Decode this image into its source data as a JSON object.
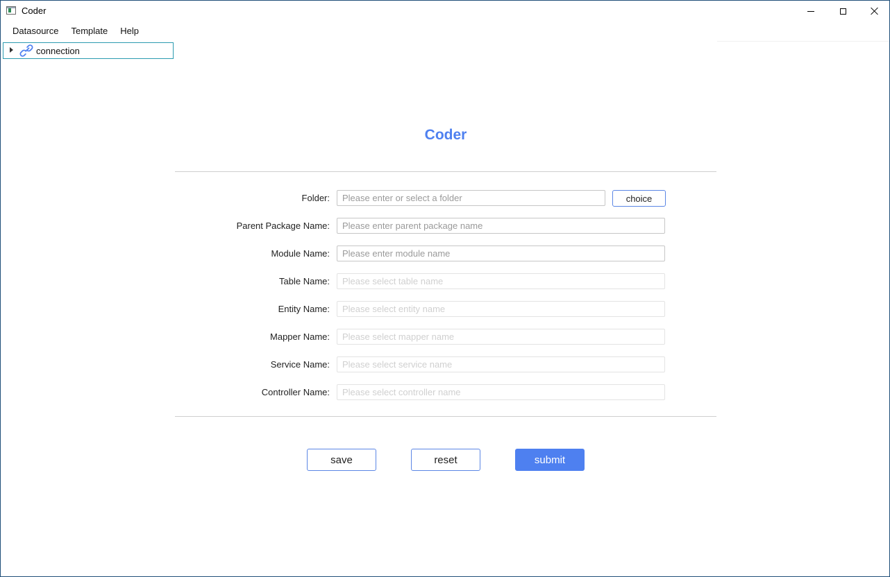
{
  "window": {
    "title": "Coder"
  },
  "menu": {
    "items": [
      "Datasource",
      "Template",
      "Help"
    ]
  },
  "tree": {
    "root_label": "connection"
  },
  "form": {
    "heading": "Coder",
    "fields": [
      {
        "label": "Folder:",
        "placeholder": "Please enter or select a folder",
        "enabled": true
      },
      {
        "label": "Parent Package Name:",
        "placeholder": "Please enter parent package name",
        "enabled": true
      },
      {
        "label": "Module Name:",
        "placeholder": "Please enter module name",
        "enabled": true
      },
      {
        "label": "Table Name:",
        "placeholder": "Please select table name",
        "enabled": false
      },
      {
        "label": "Entity Name:",
        "placeholder": "Please select entity name",
        "enabled": false
      },
      {
        "label": "Mapper Name:",
        "placeholder": "Please select mapper name",
        "enabled": false
      },
      {
        "label": "Service Name:",
        "placeholder": "Please select service name",
        "enabled": false
      },
      {
        "label": "Controller Name:",
        "placeholder": "Please select controller name",
        "enabled": false
      }
    ],
    "choice_label": "choice"
  },
  "actions": {
    "save_label": "save",
    "reset_label": "reset",
    "submit_label": "submit"
  },
  "colors": {
    "accent": "#4e80f0",
    "button_border": "#5b86e5",
    "tree_selection_border": "#2b9bb0",
    "window_border": "#1f4e79"
  },
  "icons": {
    "app": "app-window-icon",
    "tree_expand": "triangle-right-icon",
    "connection": "link-icon"
  }
}
